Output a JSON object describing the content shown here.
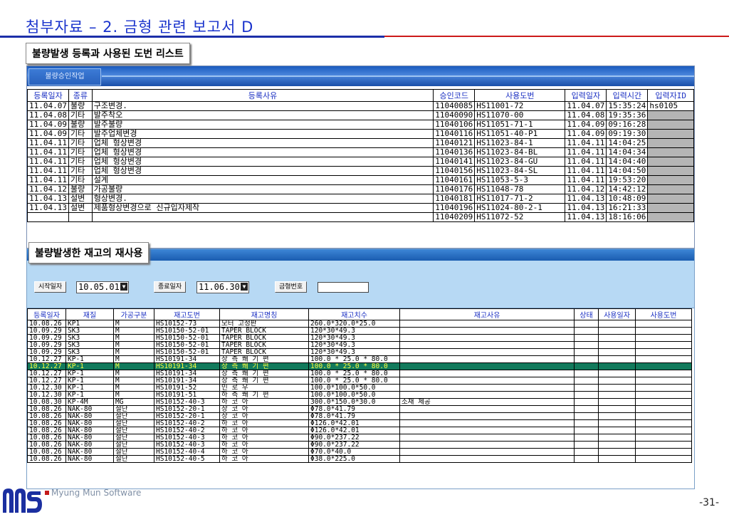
{
  "slide": {
    "title": "첨부자료 – 2. 금형 관련 보고서 D",
    "callout1": "불량발생 등록과 사용된 도번 리스트",
    "callout2": "불량발생한 재고의 재사용",
    "company": "Myung Mun Software",
    "page": "-31-"
  },
  "panel1": {
    "tab": "불량승인작업",
    "columns": [
      "등록일자",
      "종류",
      "등록사유",
      "승인코드",
      "사용도번",
      "입력일자",
      "입력시간",
      "입력자ID"
    ],
    "rows": [
      [
        "11.04.07",
        "불량",
        "구조변경.",
        "11040085",
        "HS11001-72",
        "11.04.07",
        "15:35:24",
        "hs0105"
      ],
      [
        "11.04.08",
        "기타",
        "발주착오",
        "11040090",
        "HS11070-00",
        "11.04.08",
        "19:35:36",
        ""
      ],
      [
        "11.04.09",
        "불량",
        "발주불량",
        "11040106",
        "HS11051-71-1",
        "11.04.09",
        "09:16:28",
        ""
      ],
      [
        "11.04.09",
        "기타",
        "발주업체변경",
        "11040116",
        "HS11051-40-P1",
        "11.04.09",
        "09:19:30",
        ""
      ],
      [
        "11.04.11",
        "기타",
        "업체 형상변경",
        "11040121",
        "HS11023-84-1",
        "11.04.11",
        "14:04:25",
        ""
      ],
      [
        "11.04.11",
        "기타",
        "업체 형상변경",
        "11040136",
        "HS11023-84-BL",
        "11.04.11",
        "14:04:34",
        ""
      ],
      [
        "11.04.11",
        "기타",
        "업체 형상변경",
        "11040141",
        "HS11023-84-GU",
        "11.04.11",
        "14:04:40",
        ""
      ],
      [
        "11.04.11",
        "기타",
        "업체 형상변경",
        "11040156",
        "HS11023-84-SL",
        "11.04.11",
        "14:04:50",
        ""
      ],
      [
        "11.04.11",
        "기타",
        "설계",
        "11040161",
        "HS11053-5-3",
        "11.04.11",
        "19:53:20",
        ""
      ],
      [
        "11.04.12",
        "불량",
        "가공불량",
        "11040176",
        "HS11048-78",
        "11.04.12",
        "14:42:12",
        ""
      ],
      [
        "11.04.13",
        "설변",
        "형상변경.",
        "11040181",
        "HS11017-71-2",
        "11.04.13",
        "10:48:09",
        ""
      ],
      [
        "11.04.13",
        "설변",
        "제품형상변경으로 신규입자제작",
        "11040196",
        "HS11024-80-2-1",
        "11.04.13",
        "16:21:33",
        ""
      ],
      [
        "",
        "",
        "",
        "11040209",
        "HS11072-52",
        "11.04.13",
        "18:16:06",
        ""
      ]
    ]
  },
  "panel2": {
    "start_label": "시작일자",
    "start_value": "10.05.01",
    "end_label": "종료일자",
    "end_value": "11.06.30",
    "mold_label": "금형번호",
    "mold_value": "",
    "columns": [
      "등록일자",
      "재질",
      "가공구분",
      "재고도번",
      "재고명칭",
      "재고치수",
      "재고사유",
      "상태",
      "사용일자",
      "사용도번"
    ],
    "selected_row": 6,
    "rows": [
      [
        "10.08.26",
        "KP1",
        "M",
        "HS10152-73",
        "모터 고정판",
        "260.0*320.0*25.0",
        "",
        "",
        "",
        ""
      ],
      [
        "10.09.29",
        "SK3",
        "M",
        "HS10150-52-01",
        "TAPER BLOCK",
        "120*30*49.3",
        "",
        "",
        "",
        ""
      ],
      [
        "10.09.29",
        "SK3",
        "M",
        "HS10150-52-01",
        "TAPER BLOCK",
        "120*30*49.3",
        "",
        "",
        "",
        ""
      ],
      [
        "10.09.29",
        "SK3",
        "M",
        "HS10150-52-01",
        "TAPER BLOCK",
        "120*30*49.3",
        "",
        "",
        "",
        ""
      ],
      [
        "10.09.29",
        "SK3",
        "M",
        "HS10150-52-01",
        "TAPER BLOCK",
        "120*30*49.3",
        "",
        "",
        "",
        ""
      ],
      [
        "10.12.27",
        "KP-1",
        "M",
        "HS10191-34",
        "상 측 쐐 기 편",
        "100.0 * 25.0 * 80.0",
        "",
        "",
        "",
        ""
      ],
      [
        "10.12.27",
        "KP-1",
        "M",
        "HS10191-34",
        "상 측 쐐 기 편",
        "100.0 * 25.0 * 80.0",
        "",
        "",
        "",
        ""
      ],
      [
        "10.12.27",
        "KP-1",
        "M",
        "HS10191-34",
        "상 측 쐐 기 편",
        "100.0 * 25.0 * 80.0",
        "",
        "",
        "",
        ""
      ],
      [
        "10.12.27",
        "KP-1",
        "M",
        "HS10191-34",
        "상 측 쐐 기 편",
        "100.0 * 25.0 * 80.0",
        "",
        "",
        "",
        ""
      ],
      [
        "10.12.30",
        "KP-1",
        "M",
        "HS10191-52",
        "인 로 우",
        "100.0*100.0*50.0",
        "",
        "",
        "",
        ""
      ],
      [
        "10.12.30",
        "KP-1",
        "M",
        "HS10191-51",
        "하 측 쐐 기 편",
        "100.0*100.0*50.0",
        "",
        "",
        "",
        ""
      ],
      [
        "10.08.30",
        "KP-4M",
        "MG",
        "HS10152-40-3",
        "하 코 아",
        "300.0*150.0*30.0",
        "소재 제공",
        "",
        "",
        ""
      ],
      [
        "10.08.26",
        "NAK-80",
        "절단",
        "HS10152-20-1",
        "상 코 아",
        "Φ78.0*41.79",
        "",
        "",
        "",
        ""
      ],
      [
        "10.08.26",
        "NAK-80",
        "절단",
        "HS10152-20-1",
        "상 코 아",
        "Φ78.0*41.79",
        "",
        "",
        "",
        ""
      ],
      [
        "10.08.26",
        "NAK-80",
        "절단",
        "HS10152-40-2",
        "하 코 아",
        "Φ126.0*42.01",
        "",
        "",
        "",
        ""
      ],
      [
        "10.08.26",
        "NAK-80",
        "절단",
        "HS10152-40-2",
        "하 코 아",
        "Φ126.0*42.01",
        "",
        "",
        "",
        ""
      ],
      [
        "10.08.26",
        "NAK-80",
        "절단",
        "HS10152-40-3",
        "하 코 아",
        "Φ90.0*237.22",
        "",
        "",
        "",
        ""
      ],
      [
        "10.08.26",
        "NAK-80",
        "절단",
        "HS10152-40-3",
        "하 코 아",
        "Φ90.0*237.22",
        "",
        "",
        "",
        ""
      ],
      [
        "10.08.26",
        "NAK-80",
        "절단",
        "HS10152-40-4",
        "하 코 아",
        "Φ70.0*40.0",
        "",
        "",
        "",
        ""
      ],
      [
        "10.08.26",
        "NAK-80",
        "절단",
        "HS10152-40-5",
        "하 코 아",
        "Φ38.0*225.0",
        "",
        "",
        "",
        ""
      ]
    ]
  },
  "colors": {
    "title": "#1a33cc",
    "selected_row_bg": "#127a5c",
    "selected_row_text": "#ffff40",
    "header_text": "#1a2fc2"
  }
}
